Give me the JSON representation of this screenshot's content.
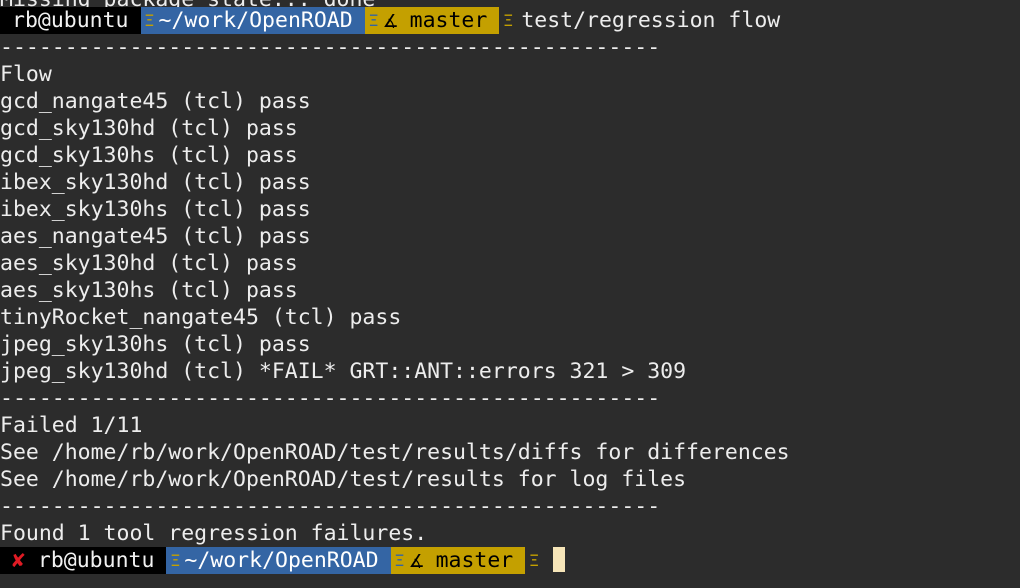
{
  "top_cut_text": "Missing package state... done",
  "prompt1": {
    "user": "rb@ubuntu",
    "path": "~/work/OpenROAD",
    "branch_icon": "git-branch-icon",
    "branch": "master",
    "command": "test/regression flow"
  },
  "output_lines": [
    "---------------------------------------------------",
    "Flow",
    "gcd_nangate45 (tcl) pass",
    "gcd_sky130hd (tcl) pass",
    "gcd_sky130hs (tcl) pass",
    "ibex_sky130hd (tcl) pass",
    "ibex_sky130hs (tcl) pass",
    "aes_nangate45 (tcl) pass",
    "aes_sky130hd (tcl) pass",
    "aes_sky130hs (tcl) pass",
    "tinyRocket_nangate45 (tcl) pass",
    "jpeg_sky130hs (tcl) pass",
    "jpeg_sky130hd (tcl) *FAIL* GRT::ANT::errors 321 > 309",
    "---------------------------------------------------",
    "Failed 1/11",
    "See /home/rb/work/OpenROAD/test/results/diffs for differences",
    "See /home/rb/work/OpenROAD/test/results for log files",
    "---------------------------------------------------",
    "Found 1 tool regression failures."
  ],
  "prompt2": {
    "status_icon": "fail-x-icon",
    "status_glyph": "✘",
    "user": "rb@ubuntu",
    "path": "~/work/OpenROAD",
    "branch": "master"
  },
  "colors": {
    "background": "#2c2c2c",
    "foreground": "#ededed",
    "segment_user": "#000000",
    "segment_path": "#3465a4",
    "segment_branch": "#c4a000",
    "fail_red": "#e01b24",
    "cursor": "#f6e5b8"
  }
}
